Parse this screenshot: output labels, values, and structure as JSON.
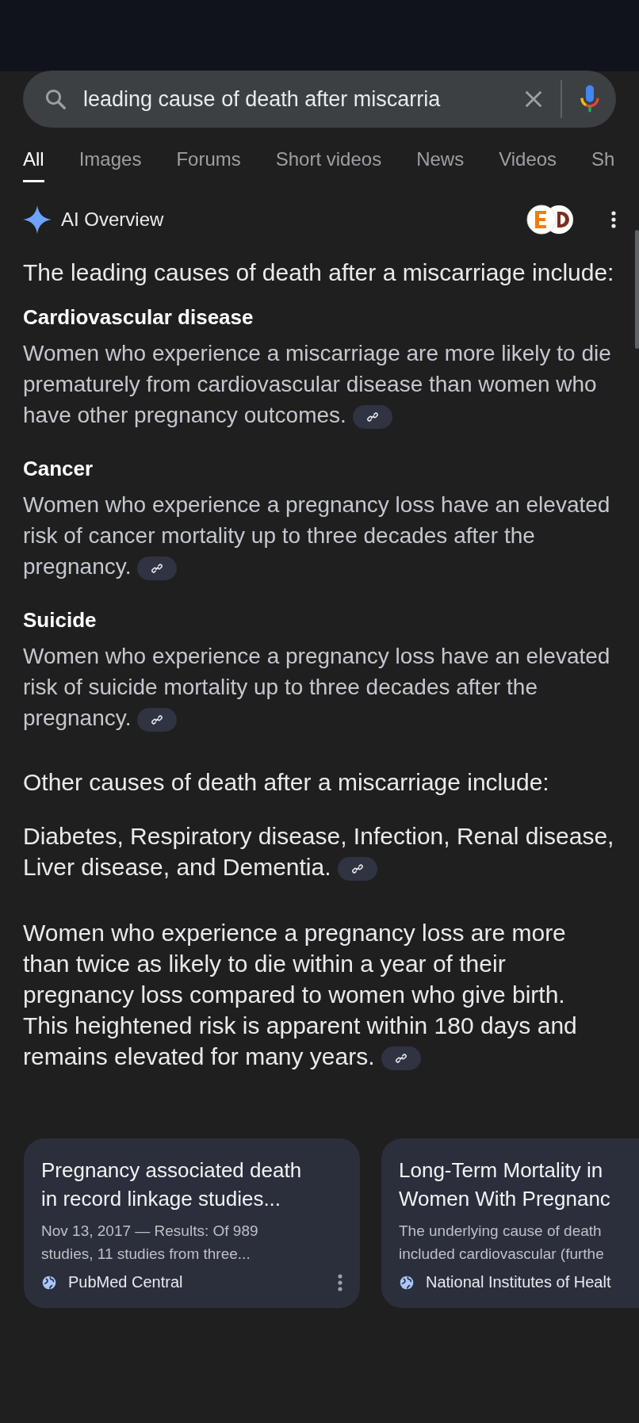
{
  "search": {
    "value": "leading cause of death after miscarria"
  },
  "tabs": [
    {
      "label": "All",
      "selected": true
    },
    {
      "label": "Images",
      "selected": false
    },
    {
      "label": "Forums",
      "selected": false
    },
    {
      "label": "Short videos",
      "selected": false
    },
    {
      "label": "News",
      "selected": false
    },
    {
      "label": "Videos",
      "selected": false
    },
    {
      "label": "Sh",
      "selected": false
    }
  ],
  "ai_overview": {
    "title": "AI Overview",
    "intro": "The leading causes of death after a miscarriage include:",
    "sections": [
      {
        "heading": "Cardiovascular disease",
        "text": "Women who experience a miscarriage are more likely to die prematurely from cardiovascular disease than women who have other pregnancy outcomes."
      },
      {
        "heading": "Cancer",
        "text": "Women who experience a pregnancy loss have an elevated risk of cancer mortality up to three decades after the pregnancy."
      },
      {
        "heading": "Suicide",
        "text": "Women who experience a pregnancy loss have an elevated risk of suicide mortality up to three decades after the pregnancy."
      }
    ],
    "subheading": "Other causes of death after a miscarriage include:",
    "paragraphs": [
      "Diabetes, Respiratory disease, Infection, Renal disease, Liver disease, and Dementia.",
      "Women who experience a pregnancy loss are more than twice as likely to die within a year of their pregnancy loss compared to women who give birth. This heightened risk is apparent within 180 days and remains elevated for many years."
    ]
  },
  "sources": [
    {
      "title_lines": [
        "Pregnancy associated death",
        "in record linkage studies..."
      ],
      "snippet_lines": [
        "Nov 13, 2017 — Results: Of 989",
        "studies, 11 studies from three..."
      ],
      "site": "PubMed Central"
    },
    {
      "title_lines": [
        "Long-Term Mortality in",
        "Women With Pregnanc"
      ],
      "snippet_lines": [
        "The underlying cause of death",
        "included cardiovascular (furthe"
      ],
      "site": "National Institutes of Healt"
    }
  ]
}
